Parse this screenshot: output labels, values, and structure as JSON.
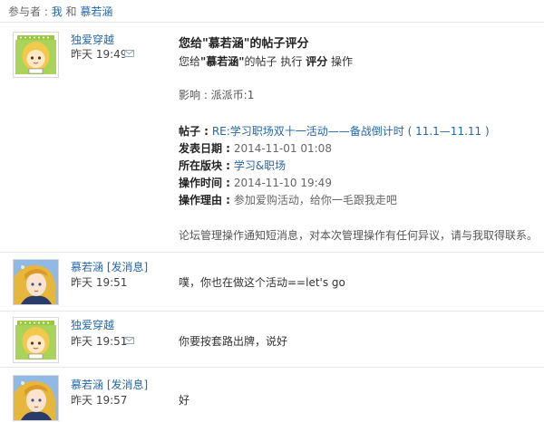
{
  "header": {
    "prefix": "参与者 :",
    "user_a": "我",
    "and": "和",
    "user_b": "慕若涵"
  },
  "notice": {
    "author": "独爱穿越",
    "time": "昨天 19:49",
    "title": "您给\"慕若涵\"的帖子评分",
    "sub_pre": "您给",
    "sub_name": "\"慕若涵\"",
    "sub_mid": "的帖子 执行",
    "sub_action": "评分",
    "sub_post": "操作",
    "effect": "影响 : 派派币:1",
    "post_label": "帖子 :",
    "post_link": "RE:学习职场双十一活动——备战倒计时 ( 11.1—11.11 )",
    "date_label": "发表日期 :",
    "date_value": "2014-11-01 01:08",
    "board_label": "所在版块 :",
    "board_link": "学习&职场",
    "optime_label": "操作时间 :",
    "optime_value": "2014-11-10 19:49",
    "reason_label": "操作理由 :",
    "reason_value": "参加爱购活动，给你一毛跟我走吧",
    "footer": "论坛管理操作通知短消息，对本次管理操作有任何异议，请与我取得联系。"
  },
  "messages": [
    {
      "author": "慕若涵",
      "send": "[发消息]",
      "time": "昨天 19:51",
      "text": "噗，你也在做这个活动==let's go"
    },
    {
      "author": "独爱穿越",
      "send": "",
      "time": "昨天 19:51",
      "text": "你要按套路出牌，说好"
    },
    {
      "author": "慕若涵",
      "send": "[发消息]",
      "time": "昨天 19:57",
      "text": "好"
    }
  ],
  "colors": {
    "link": "#2366a8",
    "divider": "#e4e9ef"
  },
  "icons": [
    "envelope-icon",
    "avatar-cartoon-girl",
    "avatar-anime-girl"
  ]
}
